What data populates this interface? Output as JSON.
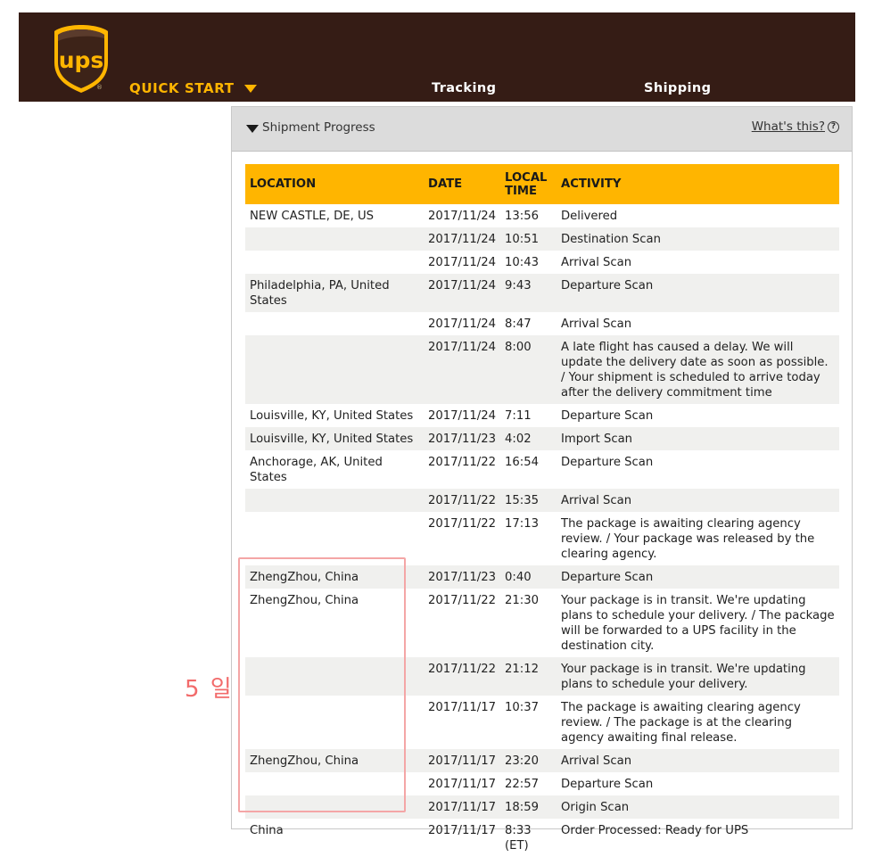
{
  "header": {
    "logo_text": "ups",
    "logo_reg": "®",
    "quick_start": "QUICK START",
    "nav": [
      "Tracking",
      "Shipping"
    ]
  },
  "panel": {
    "title": "Shipment Progress",
    "whats_this": "What's this?",
    "help_glyph": "?"
  },
  "table": {
    "headers": [
      "LOCATION",
      "DATE",
      "LOCAL TIME",
      "ACTIVITY"
    ],
    "rows": [
      {
        "location": "NEW CASTLE, DE, US",
        "date": "2017/11/24",
        "time": "13:56",
        "activity": "Delivered"
      },
      {
        "location": "",
        "date": "2017/11/24",
        "time": "10:51",
        "activity": "Destination Scan"
      },
      {
        "location": "",
        "date": "2017/11/24",
        "time": "10:43",
        "activity": "Arrival Scan"
      },
      {
        "location": "Philadelphia, PA, United States",
        "date": "2017/11/24",
        "time": "9:43",
        "activity": "Departure Scan"
      },
      {
        "location": "",
        "date": "2017/11/24",
        "time": "8:47",
        "activity": "Arrival Scan"
      },
      {
        "location": "",
        "date": "2017/11/24",
        "time": "8:00",
        "activity": "A late flight has caused a delay. We will update the delivery date as soon as possible. / Your shipment is scheduled to arrive today after the delivery commitment time"
      },
      {
        "location": "Louisville, KY, United States",
        "date": "2017/11/24",
        "time": "7:11",
        "activity": "Departure Scan"
      },
      {
        "location": "Louisville, KY, United States",
        "date": "2017/11/23",
        "time": "4:02",
        "activity": "Import Scan"
      },
      {
        "location": "Anchorage, AK, United States",
        "date": "2017/11/22",
        "time": "16:54",
        "activity": "Departure Scan"
      },
      {
        "location": "",
        "date": "2017/11/22",
        "time": "15:35",
        "activity": "Arrival Scan"
      },
      {
        "location": "",
        "date": "2017/11/22",
        "time": "17:13",
        "activity": "The package is awaiting clearing agency review. / Your package was released by the clearing agency."
      },
      {
        "location": "ZhengZhou, China",
        "date": "2017/11/23",
        "time": "0:40",
        "activity": "Departure Scan"
      },
      {
        "location": "ZhengZhou, China",
        "date": "2017/11/22",
        "time": "21:30",
        "activity": "Your package is in transit. We're updating plans to schedule your delivery. / The package will be forwarded to a UPS facility in the destination city."
      },
      {
        "location": "",
        "date": "2017/11/22",
        "time": "21:12",
        "activity": "Your package is in transit. We're updating plans to schedule your delivery."
      },
      {
        "location": "",
        "date": "2017/11/17",
        "time": "10:37",
        "activity": "The package is awaiting clearing agency review. / The package is at the clearing agency awaiting final release."
      },
      {
        "location": "ZhengZhou, China",
        "date": "2017/11/17",
        "time": "23:20",
        "activity": "Arrival Scan"
      },
      {
        "location": "",
        "date": "2017/11/17",
        "time": "22:57",
        "activity": "Departure Scan"
      },
      {
        "location": "",
        "date": "2017/11/17",
        "time": "18:59",
        "activity": "Origin Scan"
      },
      {
        "location": "China",
        "date": "2017/11/17",
        "time": "8:33 (ET)",
        "activity": "Order Processed: Ready for UPS"
      }
    ]
  },
  "annotation": {
    "text": "5 일",
    "color": "#f26b6b"
  },
  "colors": {
    "header_bg": "#351c15",
    "accent_gold": "#ffb500",
    "row_alt": "#f0f0ee"
  }
}
